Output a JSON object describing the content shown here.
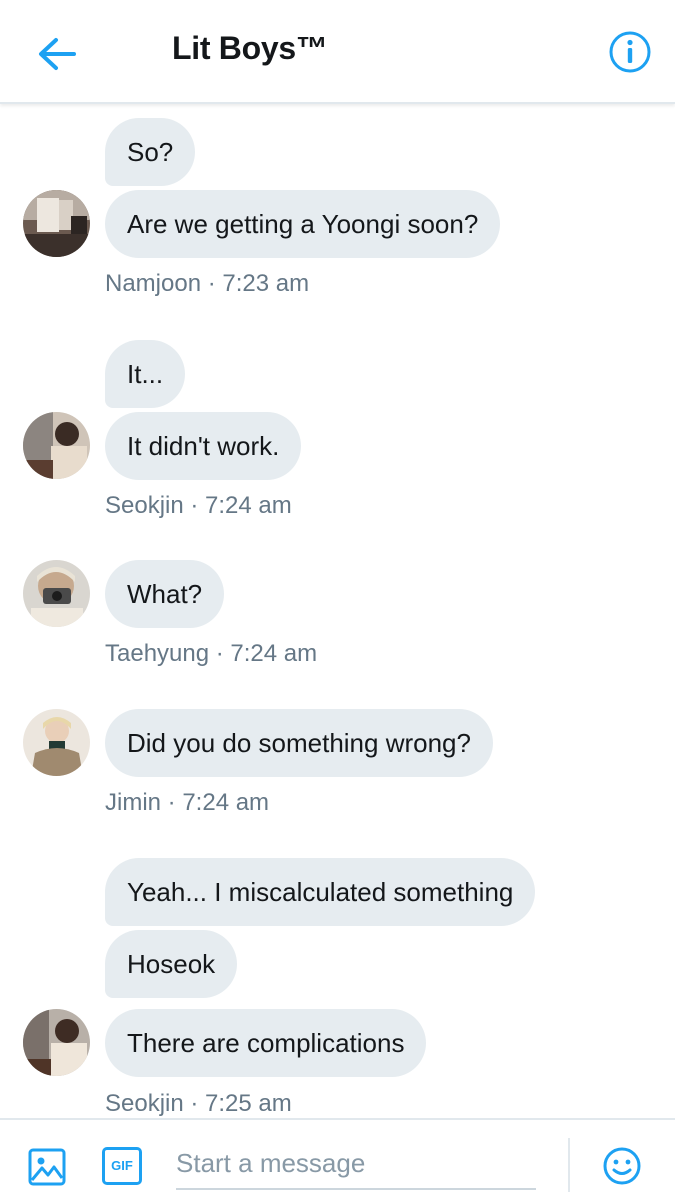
{
  "header": {
    "title": "Lit Boys™",
    "back_icon": "arrow-left-icon",
    "info_icon": "info-circle-icon"
  },
  "messages": [
    {
      "sender": "Namjoon",
      "time": "7:23 am",
      "meta": "Namjoon · 7:23 am",
      "bubbles": [
        "So?",
        "Are we getting a Yoongi soon?"
      ]
    },
    {
      "sender": "Seokjin",
      "time": "7:24 am",
      "meta": "Seokjin · 7:24 am",
      "bubbles": [
        "It...",
        "It didn't work."
      ]
    },
    {
      "sender": "Taehyung",
      "time": "7:24 am",
      "meta": "Taehyung · 7:24 am",
      "bubbles": [
        "What?"
      ]
    },
    {
      "sender": "Jimin",
      "time": "7:24 am",
      "meta": "Jimin · 7:24 am",
      "bubbles": [
        "Did you do something wrong?"
      ]
    },
    {
      "sender": "Seokjin",
      "time": "7:25 am",
      "meta": "Seokjin · 7:25 am",
      "bubbles": [
        "Yeah... I miscalculated something",
        "Hoseok",
        "There are complications"
      ]
    }
  ],
  "composer": {
    "placeholder": "Start a message",
    "gif_label": "GIF",
    "media_icon": "image-icon",
    "emoji_icon": "smiley-icon"
  },
  "colors": {
    "accent": "#1da1f2",
    "bubble_bg": "#e6ecf0",
    "meta_text": "#657786",
    "text": "#14171a"
  }
}
